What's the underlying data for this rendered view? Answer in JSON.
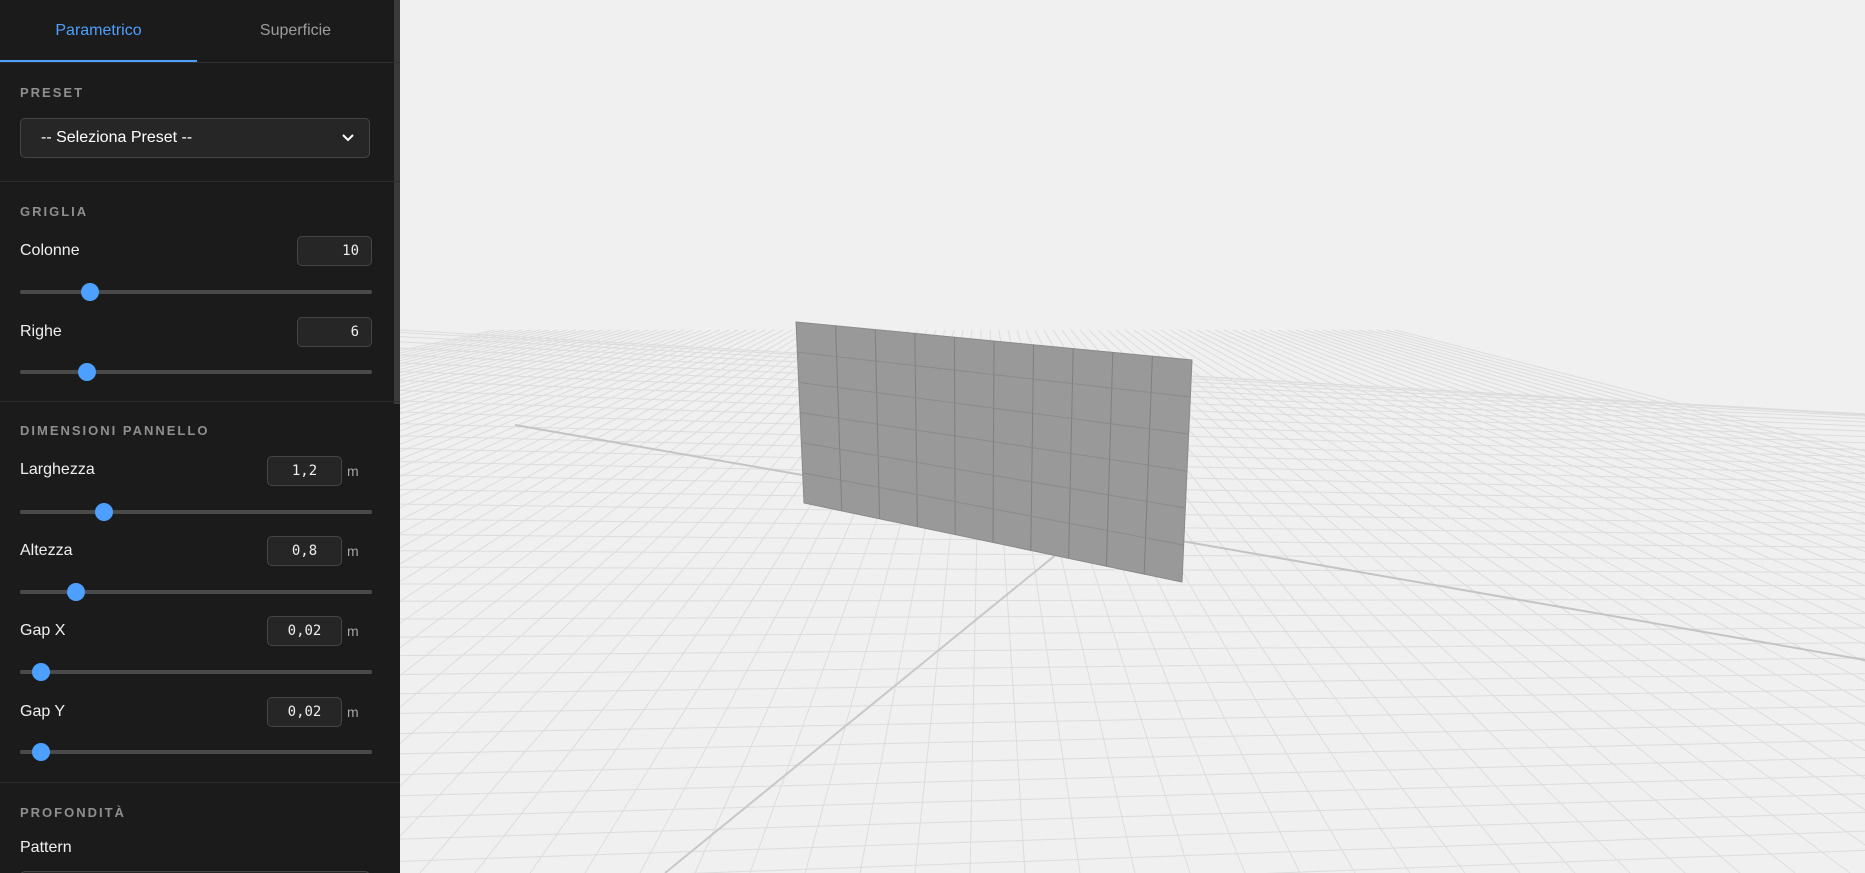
{
  "tabs": [
    {
      "label": "Parametrico",
      "active": true
    },
    {
      "label": "Superficie",
      "active": false
    }
  ],
  "preset": {
    "title": "PRESET",
    "select_value": "-- Seleziona Preset --"
  },
  "griglia": {
    "title": "GRIGLIA",
    "colonne": {
      "label": "Colonne",
      "value": "10",
      "slider_fraction": 0.2
    },
    "righe": {
      "label": "Righe",
      "value": "6",
      "slider_fraction": 0.19
    }
  },
  "dimensioni": {
    "title": "DIMENSIONI PANNELLO",
    "larghezza": {
      "label": "Larghezza",
      "value": "1,2",
      "unit": "m",
      "slider_fraction": 0.24
    },
    "altezza": {
      "label": "Altezza",
      "value": "0,8",
      "unit": "m",
      "slider_fraction": 0.16
    },
    "gap_x": {
      "label": "Gap X",
      "value": "0,02",
      "unit": "m",
      "slider_fraction": 0.06
    },
    "gap_y": {
      "label": "Gap Y",
      "value": "0,02",
      "unit": "m",
      "slider_fraction": 0.06
    }
  },
  "profondita": {
    "title": "PROFONDITÀ",
    "pattern_label": "Pattern"
  },
  "scene": {
    "background_color": "#f0f0f0",
    "grid_color": "#dcdcdc",
    "axis_color": "#c4c4c4",
    "panel_color": "#999999",
    "panel_columns": 10,
    "panel_rows": 6,
    "accent_color": "#4da0ff"
  }
}
